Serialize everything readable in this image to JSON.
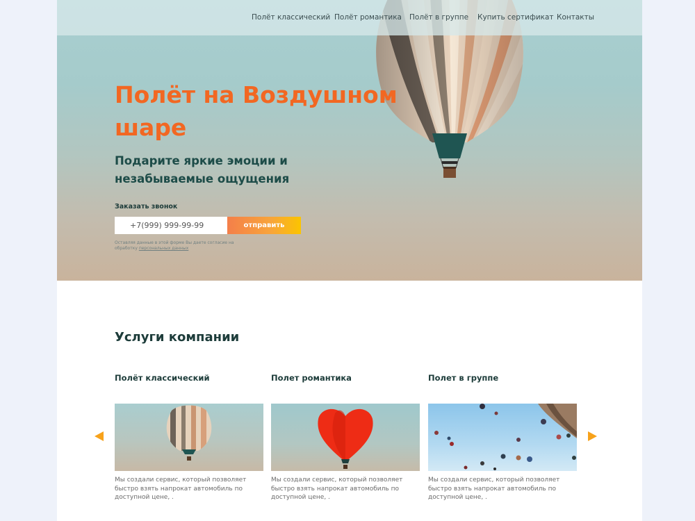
{
  "nav": {
    "items": [
      {
        "label": "Полёт классический"
      },
      {
        "label": "Полёт романтика"
      },
      {
        "label": "Полёт в группе"
      },
      {
        "label": "Купить сертификат"
      },
      {
        "label": "Контакты"
      }
    ]
  },
  "hero": {
    "title": "Полёт на Воздушном шаре",
    "subtitle": "Подарите яркие эмоции и незабываемые ощущения",
    "order_label": "Заказать звонок",
    "phone_placeholder": "+7(999) 999-99-99",
    "send_label": "отправить",
    "fine_print_text": "Оставляя данные в этой форме Вы даете согласие на обработку ",
    "fine_print_link": "персональных данных"
  },
  "services": {
    "title": "Услуги компании",
    "cards": [
      {
        "title": "Полёт классический",
        "text": "Мы создали сервис, который позволяет быстро взять напрокат автомобиль по доступной цене, ."
      },
      {
        "title": "Полет романтика",
        "text": "Мы создали сервис, который позволяет быстро взять напрокат автомобиль по доступной цене, ."
      },
      {
        "title": "Полет в группе",
        "text": "Мы создали сервис, который позволяет быстро взять напрокат автомобиль по доступной цене, ."
      }
    ]
  },
  "icons": {
    "prev": "arrow-left-icon",
    "next": "arrow-right-icon"
  },
  "colors": {
    "accent_orange": "#f26722",
    "dark_green": "#1d3c3a",
    "arrow": "#f7a21b",
    "button_gradient_start": "#f47f4a",
    "button_gradient_end": "#fbc400"
  }
}
